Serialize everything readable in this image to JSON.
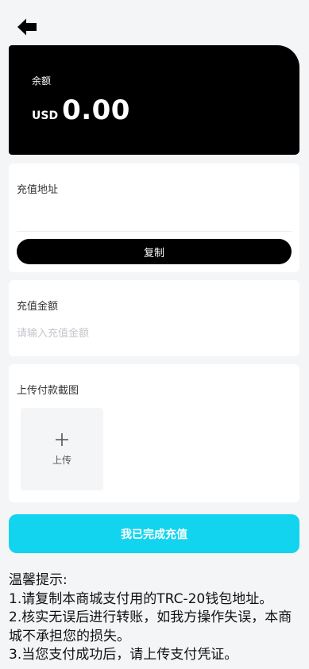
{
  "header": {
    "back_icon": "back-arrow-icon"
  },
  "balance": {
    "label": "余额",
    "currency": "USD",
    "amount": "0.00"
  },
  "address_section": {
    "title": "充值地址",
    "address": "",
    "copy_label": "复制"
  },
  "amount_section": {
    "title": "充值金额",
    "placeholder": "请输入充值金额",
    "value": ""
  },
  "upload_section": {
    "title": "上传付款截图",
    "upload_label": "上传",
    "upload_icon": "plus-icon"
  },
  "submit_label": "我已完成充值",
  "tips": {
    "heading": "温馨提示:",
    "lines": [
      "1.请复制本商城支付用的TRC-20钱包地址。",
      "2.核实无误后进行转账，如我方操作失误，本商城不承担您的损失。",
      "3.当您支付成功后，请上传支付凭证。"
    ]
  },
  "colors": {
    "page_bg": "#f4f5f7",
    "balance_card_bg": "#000000",
    "copy_button_bg": "#000000",
    "submit_button_bg": "#13d4ef",
    "placeholder": "#c4c6cc"
  }
}
